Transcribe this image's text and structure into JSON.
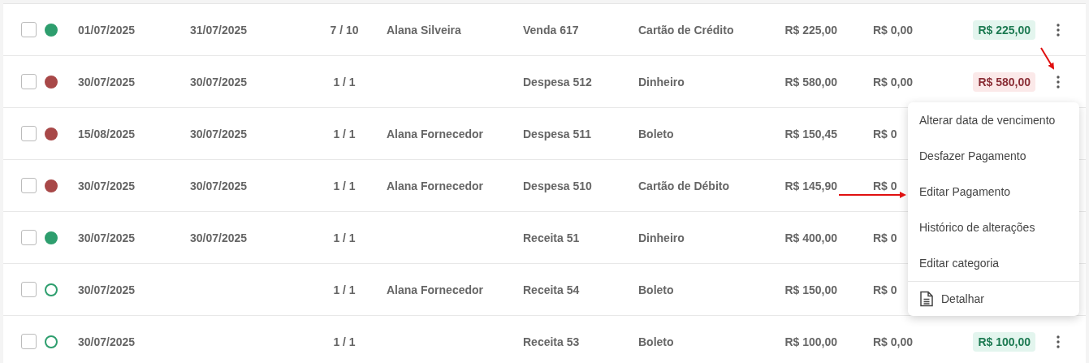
{
  "rows": [
    {
      "checked": false,
      "status": {
        "filled": true,
        "color": "#2e9e6e"
      },
      "due_date": "01/07/2025",
      "date_2": "31/07/2025",
      "installment": "7 / 10",
      "party": "Alana Silveira",
      "description": "Venda 617",
      "method": "Cartão de Crédito",
      "amount": "R$ 225,00",
      "paid": "R$ 0,00",
      "balance": {
        "text": "R$ 225,00",
        "kind": "income"
      }
    },
    {
      "checked": false,
      "status": {
        "filled": true,
        "color": "#a84848"
      },
      "due_date": "30/07/2025",
      "date_2": "30/07/2025",
      "installment": "1 / 1",
      "party": "",
      "description": "Despesa 512",
      "method": "Dinheiro",
      "amount": "R$ 580,00",
      "paid": "R$ 0,00",
      "balance": {
        "text": "R$ 580,00",
        "kind": "expense"
      }
    },
    {
      "checked": false,
      "status": {
        "filled": true,
        "color": "#a84848"
      },
      "due_date": "15/08/2025",
      "date_2": "30/07/2025",
      "installment": "1 / 1",
      "party": "Alana Fornecedor",
      "description": "Despesa 511",
      "method": "Boleto",
      "amount": "R$ 150,45",
      "paid": "R$ 0"
    },
    {
      "checked": false,
      "status": {
        "filled": true,
        "color": "#a84848"
      },
      "due_date": "30/07/2025",
      "date_2": "30/07/2025",
      "installment": "1 / 1",
      "party": "Alana Fornecedor",
      "description": "Despesa 510",
      "method": "Cartão de Débito",
      "amount": "R$ 145,90",
      "paid": "R$ 0"
    },
    {
      "checked": false,
      "status": {
        "filled": true,
        "color": "#2e9e6e"
      },
      "due_date": "30/07/2025",
      "date_2": "30/07/2025",
      "installment": "1 / 1",
      "party": "",
      "description": "Receita 51",
      "method": "Dinheiro",
      "amount": "R$ 400,00",
      "paid": "R$ 0"
    },
    {
      "checked": false,
      "status": {
        "filled": false,
        "color": "#2e9e6e"
      },
      "due_date": "30/07/2025",
      "date_2": "",
      "installment": "1 / 1",
      "party": "Alana Fornecedor",
      "description": "Receita 54",
      "method": "Boleto",
      "amount": "R$ 150,00",
      "paid": "R$ 0"
    },
    {
      "checked": false,
      "status": {
        "filled": false,
        "color": "#2e9e6e"
      },
      "due_date": "30/07/2025",
      "date_2": "",
      "installment": "1 / 1",
      "party": "",
      "description": "Receita 53",
      "method": "Boleto",
      "amount": "R$ 100,00",
      "paid": "R$ 0,00",
      "balance": {
        "text": "R$ 100,00",
        "kind": "income"
      }
    }
  ],
  "context_menu": {
    "items": [
      {
        "label": "Alterar data de vencimento",
        "kind": "text"
      },
      {
        "label": "Desfazer Pagamento",
        "kind": "text"
      },
      {
        "label": "Editar Pagamento",
        "kind": "text"
      },
      {
        "label": "Histórico de alterações",
        "kind": "text"
      },
      {
        "label": "Editar categoria",
        "kind": "text"
      },
      {
        "label": "Detalhar",
        "kind": "document"
      }
    ]
  }
}
